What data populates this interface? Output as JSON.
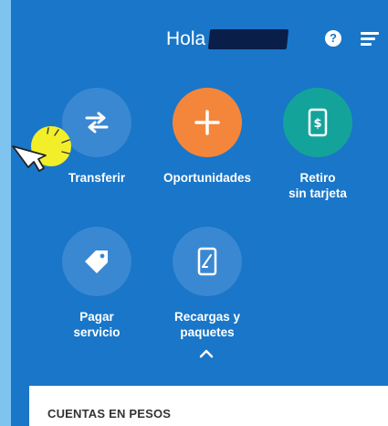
{
  "header": {
    "greeting": "Hola",
    "help_symbol": "?",
    "help_icon": "help-icon",
    "menu_icon": "menu-icon"
  },
  "actions": [
    {
      "label": "Transferir",
      "icon": "transfer-arrows-icon"
    },
    {
      "label": "Oportunidades",
      "icon": "plus-icon"
    },
    {
      "label": "Retiro\nsin tarjeta",
      "icon": "phone-cash-icon"
    },
    {
      "label": "Pagar\nservicio",
      "icon": "tag-icon"
    },
    {
      "label": "Recargas y\npaquetes",
      "icon": "phone-recharge-icon"
    }
  ],
  "collapse_icon": "chevron-up-icon",
  "accounts_card": {
    "title": "CUENTAS EN PESOS"
  },
  "colors": {
    "background": "#1976c8",
    "outer": "#7fc4ee",
    "orange": "#f4863b",
    "teal": "#14a39a",
    "cursor_highlight": "#f2ef2a"
  }
}
